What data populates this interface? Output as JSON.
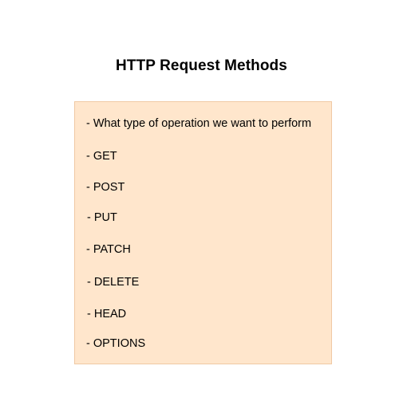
{
  "title": "HTTP Request Methods",
  "colors": {
    "box_fill": "#ffe6cc",
    "box_border": "#f0c9a4",
    "text": "#000000"
  },
  "items": [
    "- What type of operation we want to perform",
    "- GET",
    "- POST",
    "- PUT",
    "- PATCH",
    "- DELETE",
    "- HEAD",
    "- OPTIONS"
  ]
}
